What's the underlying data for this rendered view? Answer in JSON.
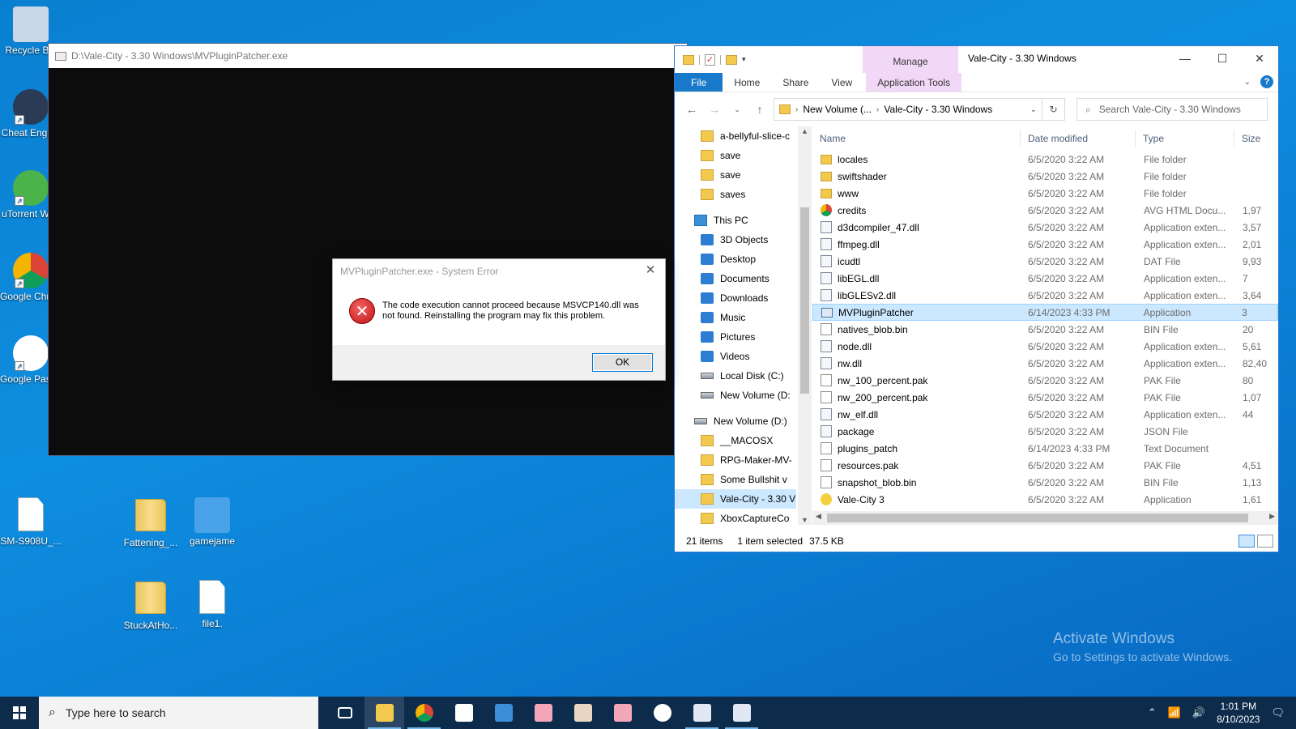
{
  "desktop": {
    "icons": [
      {
        "label": "Recycle Bin",
        "icon": "recycle-bin-icon"
      },
      {
        "label": "Cheat Engine",
        "icon": "cheat-engine-icon"
      },
      {
        "label": "uTorrent Web",
        "icon": "utorrent-icon"
      },
      {
        "label": "Google Chrome",
        "icon": "chrome-icon"
      },
      {
        "label": "Google Passwo...",
        "icon": "google-passwords-icon"
      },
      {
        "label": "SM-S908U_...",
        "icon": "document-icon"
      },
      {
        "label": "Fattening_...",
        "icon": "folder-icon"
      },
      {
        "label": "gamejame",
        "icon": "game-icon"
      },
      {
        "label": "StuckAtHo...",
        "icon": "folder-icon"
      },
      {
        "label": "file1.",
        "icon": "notepad-icon"
      }
    ]
  },
  "console": {
    "title": "D:\\Vale-City - 3.30 Windows\\MVPluginPatcher.exe"
  },
  "dialog": {
    "title": "MVPluginPatcher.exe - System Error",
    "message": "The code execution cannot proceed because MSVCP140.dll was not found. Reinstalling the program may fix this problem.",
    "ok_label": "OK"
  },
  "explorer": {
    "title": "Vale-City - 3.30 Windows",
    "manage_label": "Manage",
    "tabs": [
      "File",
      "Home",
      "Share",
      "View",
      "Application Tools"
    ],
    "address": {
      "segments": [
        "New Volume (...",
        "Vale-City - 3.30 Windows"
      ]
    },
    "search_placeholder": "Search Vale-City - 3.30 Windows",
    "nav": [
      {
        "label": "a-bellyful-slice-c",
        "icon": "folder",
        "indent": 1
      },
      {
        "label": "save",
        "icon": "folder",
        "indent": 1
      },
      {
        "label": "save",
        "icon": "folder",
        "indent": 1
      },
      {
        "label": "saves",
        "icon": "folder",
        "indent": 1
      },
      {
        "label": "This PC",
        "icon": "pc",
        "indent": 0
      },
      {
        "label": "3D Objects",
        "icon": "blue",
        "indent": 1
      },
      {
        "label": "Desktop",
        "icon": "blue",
        "indent": 1
      },
      {
        "label": "Documents",
        "icon": "blue",
        "indent": 1
      },
      {
        "label": "Downloads",
        "icon": "blue",
        "indent": 1
      },
      {
        "label": "Music",
        "icon": "blue",
        "indent": 1
      },
      {
        "label": "Pictures",
        "icon": "blue",
        "indent": 1
      },
      {
        "label": "Videos",
        "icon": "blue",
        "indent": 1
      },
      {
        "label": "Local Disk (C:)",
        "icon": "drive",
        "indent": 1
      },
      {
        "label": "New Volume (D:",
        "icon": "drive",
        "indent": 1
      },
      {
        "label": "New Volume (D:)",
        "icon": "drive",
        "indent": 0
      },
      {
        "label": "__MACOSX",
        "icon": "folder",
        "indent": 1
      },
      {
        "label": "RPG-Maker-MV-",
        "icon": "folder",
        "indent": 1
      },
      {
        "label": "Some Bullshit v",
        "icon": "folder",
        "indent": 1
      },
      {
        "label": "Vale-City - 3.30 V",
        "icon": "folder",
        "indent": 1,
        "selected": true
      },
      {
        "label": "XboxCaptureCo",
        "icon": "folder",
        "indent": 1
      }
    ],
    "columns": [
      "Name",
      "Date modified",
      "Type",
      "Size"
    ],
    "files": [
      {
        "name": "locales",
        "date": "6/5/2020 3:22 AM",
        "type": "File folder",
        "size": "",
        "icon": "folder"
      },
      {
        "name": "swiftshader",
        "date": "6/5/2020 3:22 AM",
        "type": "File folder",
        "size": "",
        "icon": "folder"
      },
      {
        "name": "www",
        "date": "6/5/2020 3:22 AM",
        "type": "File folder",
        "size": "",
        "icon": "folder"
      },
      {
        "name": "credits",
        "date": "6/5/2020 3:22 AM",
        "type": "AVG HTML Docu...",
        "size": "1,97",
        "icon": "chrome"
      },
      {
        "name": "d3dcompiler_47.dll",
        "date": "6/5/2020 3:22 AM",
        "type": "Application exten...",
        "size": "3,57",
        "icon": "dll"
      },
      {
        "name": "ffmpeg.dll",
        "date": "6/5/2020 3:22 AM",
        "type": "Application exten...",
        "size": "2,01",
        "icon": "dll"
      },
      {
        "name": "icudtl",
        "date": "6/5/2020 3:22 AM",
        "type": "DAT File",
        "size": "9,93",
        "icon": "dll"
      },
      {
        "name": "libEGL.dll",
        "date": "6/5/2020 3:22 AM",
        "type": "Application exten...",
        "size": "7",
        "icon": "dll"
      },
      {
        "name": "libGLESv2.dll",
        "date": "6/5/2020 3:22 AM",
        "type": "Application exten...",
        "size": "3,64",
        "icon": "dll"
      },
      {
        "name": "MVPluginPatcher",
        "date": "6/14/2023 4:33 PM",
        "type": "Application",
        "size": "3",
        "icon": "app",
        "selected": true
      },
      {
        "name": "natives_blob.bin",
        "date": "6/5/2020 3:22 AM",
        "type": "BIN File",
        "size": "20",
        "icon": "file"
      },
      {
        "name": "node.dll",
        "date": "6/5/2020 3:22 AM",
        "type": "Application exten...",
        "size": "5,61",
        "icon": "dll"
      },
      {
        "name": "nw.dll",
        "date": "6/5/2020 3:22 AM",
        "type": "Application exten...",
        "size": "82,40",
        "icon": "dll"
      },
      {
        "name": "nw_100_percent.pak",
        "date": "6/5/2020 3:22 AM",
        "type": "PAK File",
        "size": "80",
        "icon": "file"
      },
      {
        "name": "nw_200_percent.pak",
        "date": "6/5/2020 3:22 AM",
        "type": "PAK File",
        "size": "1,07",
        "icon": "file"
      },
      {
        "name": "nw_elf.dll",
        "date": "6/5/2020 3:22 AM",
        "type": "Application exten...",
        "size": "44",
        "icon": "dll"
      },
      {
        "name": "package",
        "date": "6/5/2020 3:22 AM",
        "type": "JSON File",
        "size": "",
        "icon": "dll"
      },
      {
        "name": "plugins_patch",
        "date": "6/14/2023 4:33 PM",
        "type": "Text Document",
        "size": "",
        "icon": "file"
      },
      {
        "name": "resources.pak",
        "date": "6/5/2020 3:22 AM",
        "type": "PAK File",
        "size": "4,51",
        "icon": "file"
      },
      {
        "name": "snapshot_blob.bin",
        "date": "6/5/2020 3:22 AM",
        "type": "BIN File",
        "size": "1,13",
        "icon": "file"
      },
      {
        "name": "Vale-City 3",
        "date": "6/5/2020 3:22 AM",
        "type": "Application",
        "size": "1,61",
        "icon": "game"
      }
    ],
    "status": {
      "items": "21 items",
      "selected": "1 item selected",
      "size": "37.5 KB"
    }
  },
  "watermark": {
    "line1": "Activate Windows",
    "line2": "Go to Settings to activate Windows."
  },
  "taskbar": {
    "search_placeholder": "Type here to search",
    "apps": [
      {
        "name": "task-view",
        "color": "#ffffff",
        "running": false,
        "active": false
      },
      {
        "name": "file-explorer",
        "color": "#f2c94c",
        "running": true,
        "active": true
      },
      {
        "name": "chrome",
        "color": "#db4437",
        "running": true,
        "active": false
      },
      {
        "name": "unity",
        "color": "#ffffff",
        "running": false,
        "active": false
      },
      {
        "name": "cheat-engine",
        "color": "#3b8fd8",
        "running": false,
        "active": false
      },
      {
        "name": "game-a",
        "color": "#f4a7b9",
        "running": false,
        "active": false
      },
      {
        "name": "game-b",
        "color": "#e8d7c3",
        "running": false,
        "active": false
      },
      {
        "name": "game-c",
        "color": "#f4a7b9",
        "running": false,
        "active": false
      },
      {
        "name": "passwords",
        "color": "#ffffff",
        "running": false,
        "active": false
      },
      {
        "name": "console-window",
        "color": "#dfe8f3",
        "running": true,
        "active": false
      },
      {
        "name": "patcher-window",
        "color": "#dfe8f3",
        "running": true,
        "active": false
      }
    ],
    "time": "1:01 PM",
    "date": "8/10/2023"
  }
}
